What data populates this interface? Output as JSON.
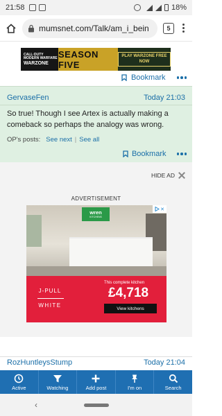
{
  "status_bar": {
    "time": "21:58",
    "battery": "18%"
  },
  "browser": {
    "url": "mumsnet.com/Talk/am_i_bein",
    "tab_count": "5"
  },
  "top_banner": {
    "brand_line1": "CALL·DUTY",
    "brand_line2": "MODERN WARFARE",
    "brand_line3": "WARZONE",
    "season": "SEASON FIVE",
    "cta": "PLAY WARZONE FREE NOW"
  },
  "post1": {
    "bookmark_label": "Bookmark"
  },
  "post2": {
    "author": "GervaseFen",
    "time": "Today 21:03",
    "body": "So true! Though I see Artex is actually making a comeback so perhaps the analogy was wrong.",
    "ops_label": "OP's posts:",
    "see_next": "See next",
    "see_all": "See all",
    "bookmark_label": "Bookmark"
  },
  "ad": {
    "hide_label": "HIDE AD",
    "advertisement_label": "ADVERTISEMENT",
    "logo_text": "wren",
    "logo_sub": "KITCHENS",
    "style_line1": "J-PULL",
    "style_line2": "WHITE",
    "tagline": "This complete kitchen",
    "price": "£4,718",
    "cta": "View kitchens"
  },
  "post3": {
    "author": "RozHuntleysStump",
    "time": "Today 21:04"
  },
  "bottom_nav": [
    {
      "label": "Active",
      "icon": "clock-icon"
    },
    {
      "label": "Watching",
      "icon": "filter-icon"
    },
    {
      "label": "Add post",
      "icon": "plus-icon"
    },
    {
      "label": "I'm on",
      "icon": "pin-icon"
    },
    {
      "label": "Search",
      "icon": "search-icon"
    }
  ],
  "colors": {
    "link": "#1b6fa8",
    "post_highlight": "#dff0e2",
    "toolbar": "#1f6fb2",
    "ad_red": "#e21f3b"
  }
}
